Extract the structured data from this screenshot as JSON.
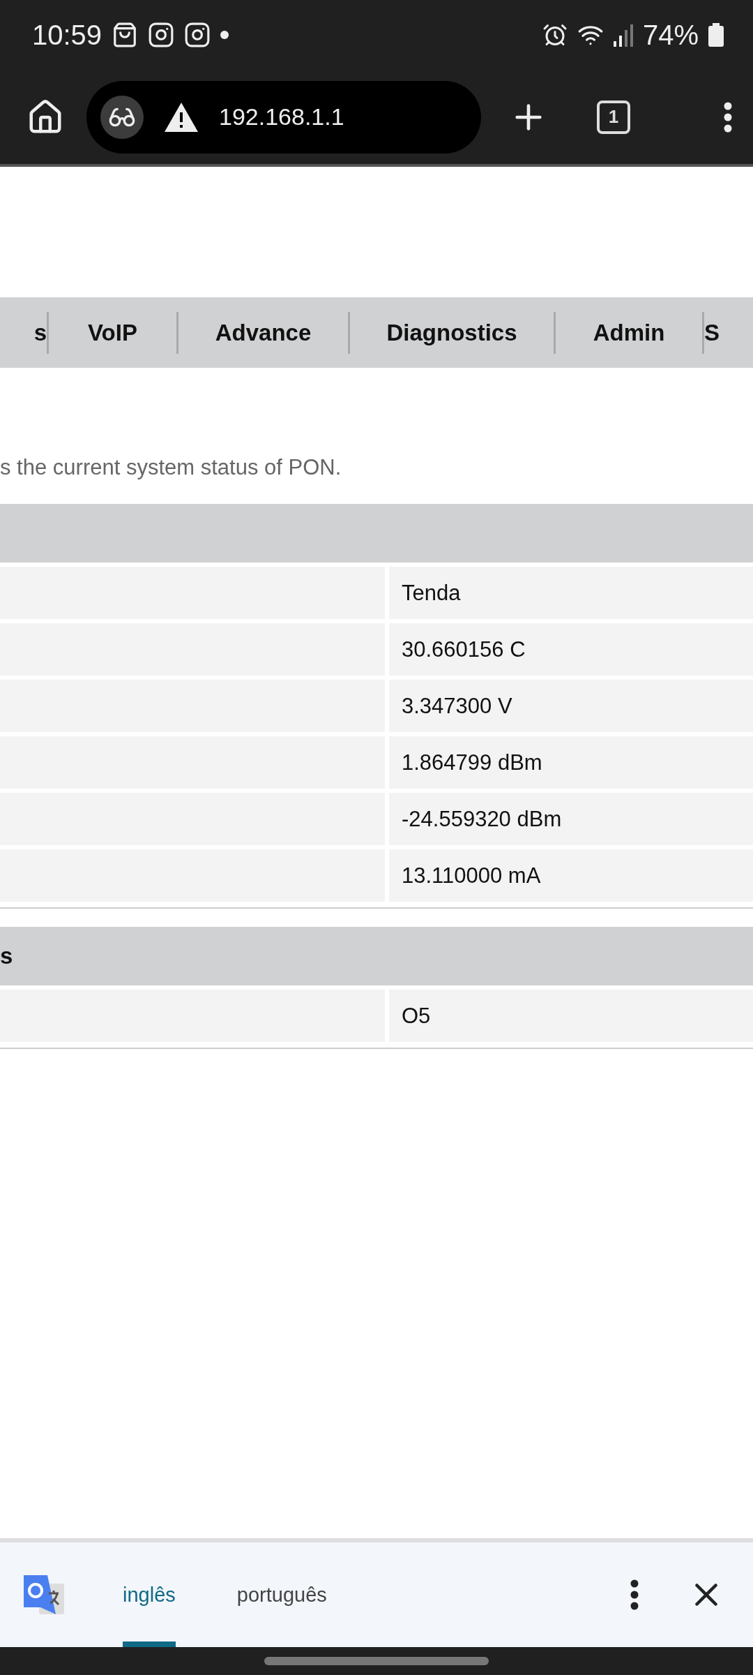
{
  "status_bar": {
    "time": "10:59",
    "battery": "74%"
  },
  "browser": {
    "url": "192.168.1.1",
    "tab_count": "1"
  },
  "nav_tabs": [
    {
      "label": "s"
    },
    {
      "label": "VoIP"
    },
    {
      "label": "Advance"
    },
    {
      "label": "Diagnostics"
    },
    {
      "label": "Admin"
    },
    {
      "label": "S"
    }
  ],
  "description": "s the current system status of PON.",
  "sections": [
    {
      "rows": [
        {
          "value": "Tenda"
        },
        {
          "value": "30.660156 C"
        },
        {
          "value": "3.347300 V"
        },
        {
          "value": "1.864799 dBm"
        },
        {
          "value": "-24.559320 dBm"
        },
        {
          "value": "13.110000 mA"
        }
      ]
    },
    {
      "title": "s",
      "rows": [
        {
          "value": "O5"
        }
      ]
    }
  ],
  "translate_bar": {
    "languages": [
      {
        "label": "inglês",
        "selected": true
      },
      {
        "label": "português",
        "selected": false
      }
    ]
  }
}
